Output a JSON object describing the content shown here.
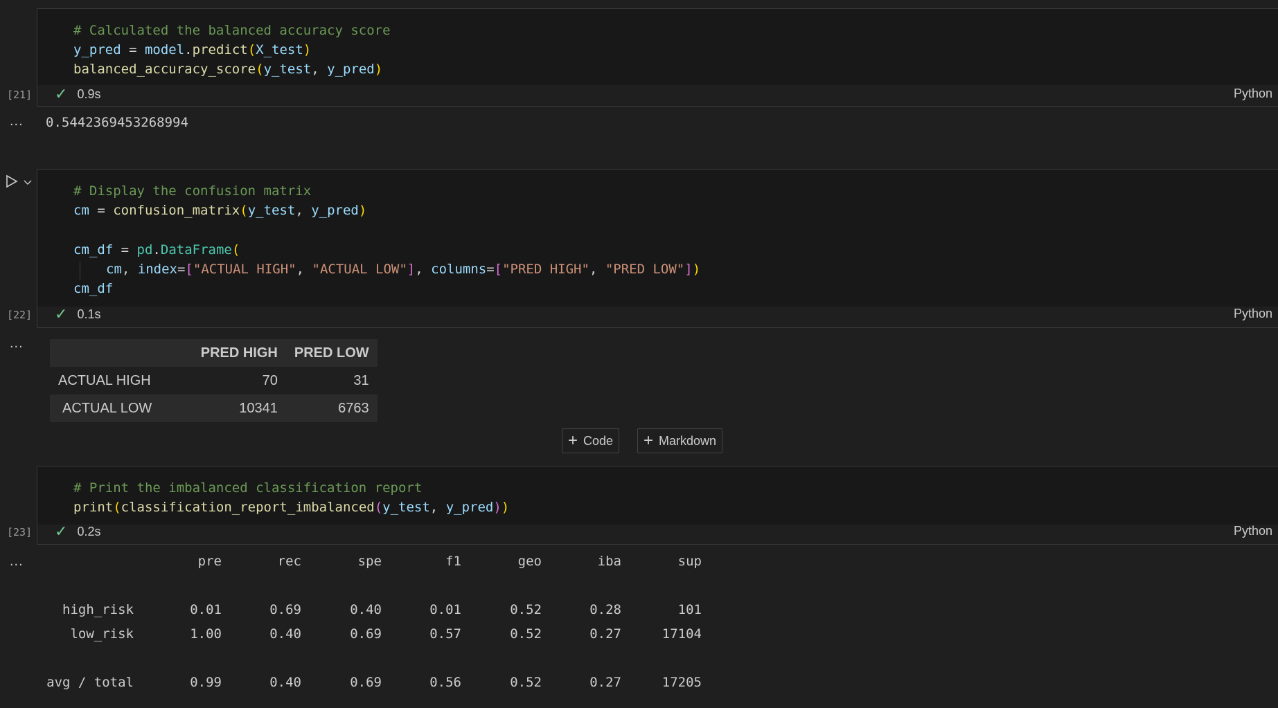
{
  "cell21": {
    "exec": "[21]",
    "lines": {
      "comment": "# Calculated the balanced accuracy score",
      "l2_var": "y_pred",
      "l2_eq": " = ",
      "l2_obj": "model",
      "l2_dot": ".",
      "l2_fn": "predict",
      "l2_arg": "X_test",
      "l3_fn": "balanced_accuracy_score",
      "l3_a1": "y_test",
      "l3_sep": ", ",
      "l3_a2": "y_pred"
    },
    "time": "0.9s",
    "lang": "Python",
    "output": "0.5442369453268994"
  },
  "cell22": {
    "exec": "[22]",
    "lines": {
      "comment": "# Display the confusion matrix",
      "l2_var": "cm",
      "l2_eq": " = ",
      "l2_fn": "confusion_matrix",
      "l2_a1": "y_test",
      "l2_sep": ", ",
      "l2_a2": "y_pred",
      "l4_var": "cm_df",
      "l4_eq": " = ",
      "l4_mod": "pd",
      "l4_dot": ".",
      "l4_fn": "DataFrame",
      "l5_cm": "cm",
      "l5_c1": ", ",
      "l5_index": "index",
      "l5_eq1": "=",
      "l5_s1": "\"ACTUAL HIGH\"",
      "l5_c2": ", ",
      "l5_s2": "\"ACTUAL LOW\"",
      "l5_c3": ", ",
      "l5_columns": "columns",
      "l5_eq2": "=",
      "l5_s3": "\"PRED HIGH\"",
      "l5_c4": ", ",
      "l5_s4": "\"PRED LOW\"",
      "l6_var": "cm_df"
    },
    "time": "0.1s",
    "lang": "Python",
    "table": {
      "columns": [
        "PRED HIGH",
        "PRED LOW"
      ],
      "rows": [
        {
          "index": "ACTUAL HIGH",
          "values": [
            "70",
            "31"
          ]
        },
        {
          "index": "ACTUAL LOW",
          "values": [
            "10341",
            "6763"
          ]
        }
      ]
    }
  },
  "add_buttons": {
    "code": "Code",
    "markdown": "Markdown"
  },
  "cell23": {
    "exec": "[23]",
    "lines": {
      "comment": "# Print the imbalanced classification report",
      "l2_fn": "print",
      "l2_fn2": "classification_report_imbalanced",
      "l2_a1": "y_test",
      "l2_sep": ", ",
      "l2_a2": "y_pred"
    },
    "time": "0.2s",
    "lang": "Python",
    "report": {
      "headers": [
        "pre",
        "rec",
        "spe",
        "f1",
        "geo",
        "iba",
        "sup"
      ],
      "rows": [
        {
          "label": "high_risk",
          "values": [
            "0.01",
            "0.69",
            "0.40",
            "0.01",
            "0.52",
            "0.28",
            "101"
          ]
        },
        {
          "label": "low_risk",
          "values": [
            "1.00",
            "0.40",
            "0.69",
            "0.57",
            "0.52",
            "0.27",
            "17104"
          ]
        },
        {
          "label": "avg / total",
          "values": [
            "0.99",
            "0.40",
            "0.69",
            "0.56",
            "0.52",
            "0.27",
            "17205"
          ]
        }
      ]
    }
  },
  "output_more": "...",
  "icons": {
    "run": "run-icon",
    "chevron": "chevron-down-icon",
    "check": "check-icon",
    "plus": "plus-icon"
  }
}
